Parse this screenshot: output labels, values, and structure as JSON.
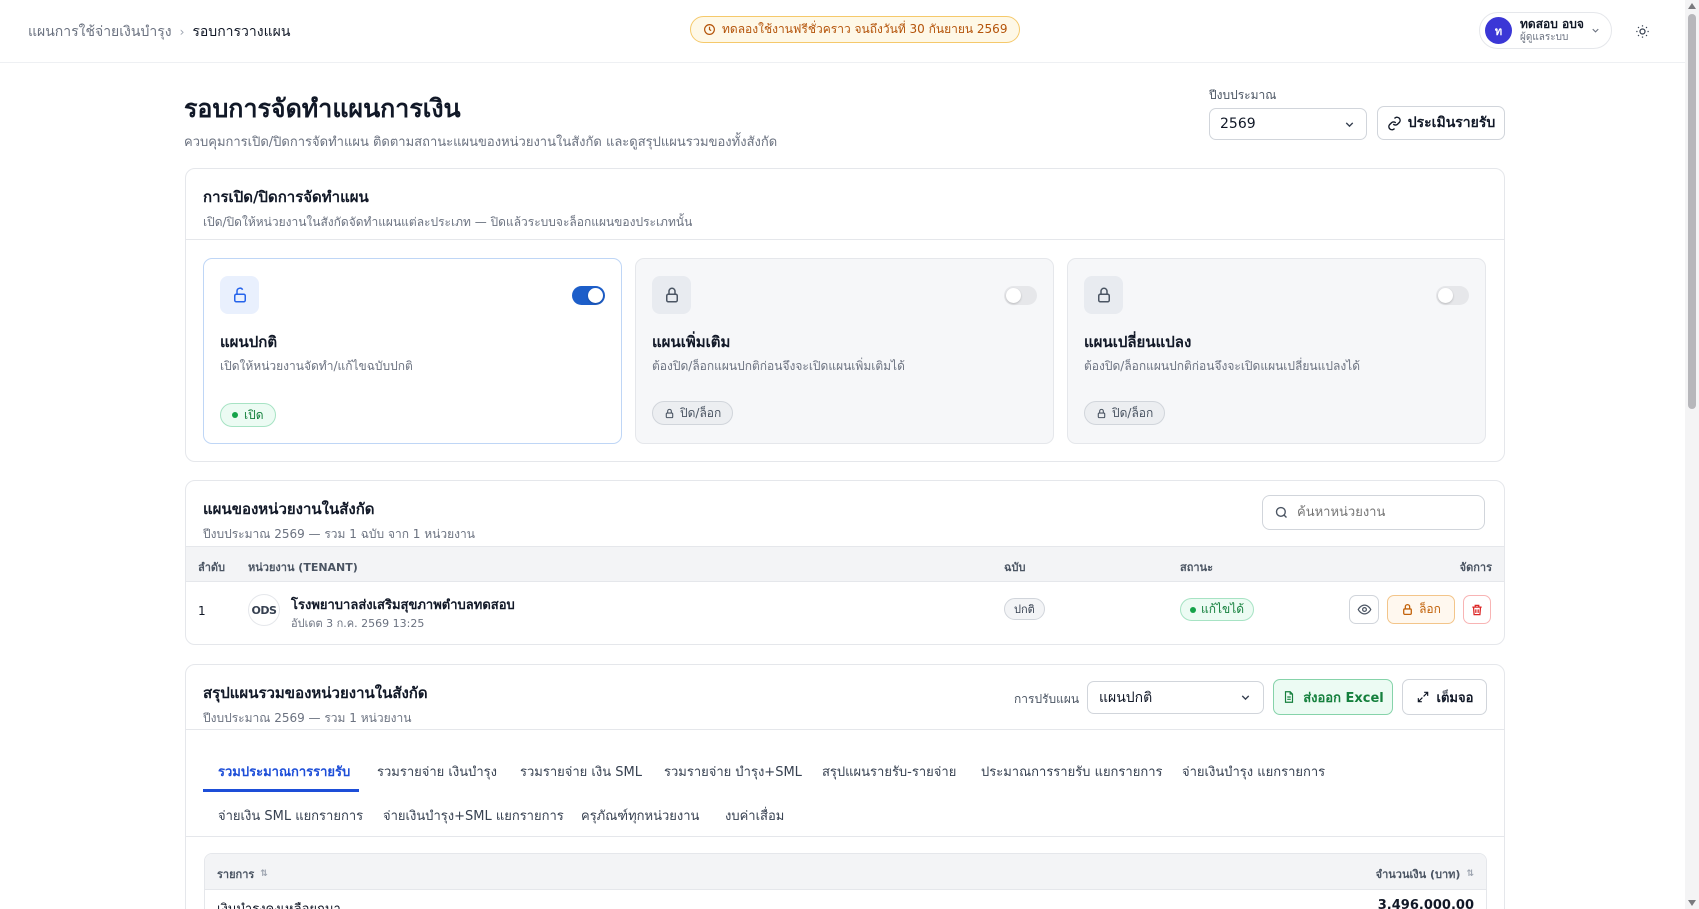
{
  "breadcrumb": {
    "parent": "แผนการใช้จ่ายเงินบำรุง",
    "current": "รอบการวางแผน"
  },
  "trial_notice": "ทดลองใช้งานฟรีชั่วคราว จนถึงวันที่ 30 กันยายน 2569",
  "user": {
    "initial": "ท",
    "name": "ทดสอบ อบจ",
    "role": "ผู้ดูแลระบบ"
  },
  "page": {
    "title": "รอบการจัดทำแผนการเงิน",
    "subtitle": "ควบคุมการเปิด/ปิดการจัดทำแผน ติดตามสถานะแผนของหน่วยงานในสังกัด และดูสรุปแผนรวมของทั้งสังกัด",
    "fiscal_year_label": "ปีงบประมาณ",
    "fiscal_year_value": "2569",
    "evaluate_button": "ประเมินรายรับ"
  },
  "plan_control": {
    "title": "การเปิด/ปิดการจัดทำแผน",
    "subtitle": "เปิด/ปิดให้หน่วยงานในสังกัดจัดทำแผนแต่ละประเภท — ปิดแล้วระบบจะล็อกแผนของประเภทนั้น",
    "plans": [
      {
        "name": "แผนปกติ",
        "desc": "เปิดให้หน่วยงานจัดทำ/แก้ไขฉบับปกติ",
        "status": "เปิด",
        "enabled": true
      },
      {
        "name": "แผนเพิ่มเติม",
        "desc": "ต้องปิด/ล็อกแผนปกติก่อนจึงจะเปิดแผนเพิ่มเติมได้",
        "status": "ปิด/ล็อก",
        "enabled": false
      },
      {
        "name": "แผนเปลี่ยนแปลง",
        "desc": "ต้องปิด/ล็อกแผนปกติก่อนจึงจะเปิดแผนเปลี่ยนแปลงได้",
        "status": "ปิด/ล็อก",
        "enabled": false
      }
    ]
  },
  "tenants": {
    "title": "แผนของหน่วยงานในสังกัด",
    "subtitle": "ปีงบประมาณ 2569 — รวม 1 ฉบับ จาก 1 หน่วยงาน",
    "search_placeholder": "ค้นหาหน่วยงาน",
    "columns": {
      "no": "ลำดับ",
      "tenant": "หน่วยงาน (TENANT)",
      "version": "ฉบับ",
      "status": "สถานะ",
      "actions": "จัดการ"
    },
    "rows": [
      {
        "no": "1",
        "logo": "ODS",
        "name": "โรงพยาบาลส่งเสริมสุขภาพตำบลทดสอบ",
        "updated": "อัปเดต 3 ก.ค. 2569 13:25",
        "version": "ปกติ",
        "status": "แก้ไขได้",
        "lock_label": "ล็อก"
      }
    ]
  },
  "summary": {
    "title": "สรุปแผนรวมของหน่วยงานในสังกัด",
    "subtitle": "ปีงบประมาณ 2569 — รวม 1 หน่วยงาน",
    "adjust_label": "การปรับแผน",
    "adjust_value": "แผนปกติ",
    "export_button": "ส่งออก Excel",
    "fullscreen_button": "เต็มจอ",
    "tabs": [
      "รวมประมาณการรายรับ",
      "รวมรายจ่าย เงินบำรุง",
      "รวมรายจ่าย เงิน SML",
      "รวมรายจ่าย บำรุง+SML",
      "สรุปแผนรายรับ-รายจ่าย",
      "ประมาณการรายรับ แยกรายการ",
      "จ่ายเงินบำรุง แยกรายการ",
      "จ่ายเงิน SML แยกรายการ",
      "จ่ายเงินบำรุง+SML แยกรายการ",
      "ครุภัณฑ์ทุกหน่วยงาน",
      "งบค่าเสื่อม"
    ],
    "table_columns": {
      "item": "รายการ",
      "amount": "จำนวนเงิน (บาท)"
    },
    "table_rows": [
      {
        "item": "เงินบำรุงคงเหลือยกมา",
        "amount": "3,496,000.00"
      }
    ]
  },
  "colors": {
    "primary": "#1d4ed8",
    "success": "#15803d",
    "warning": "#c2620a",
    "danger": "#dc2626"
  }
}
